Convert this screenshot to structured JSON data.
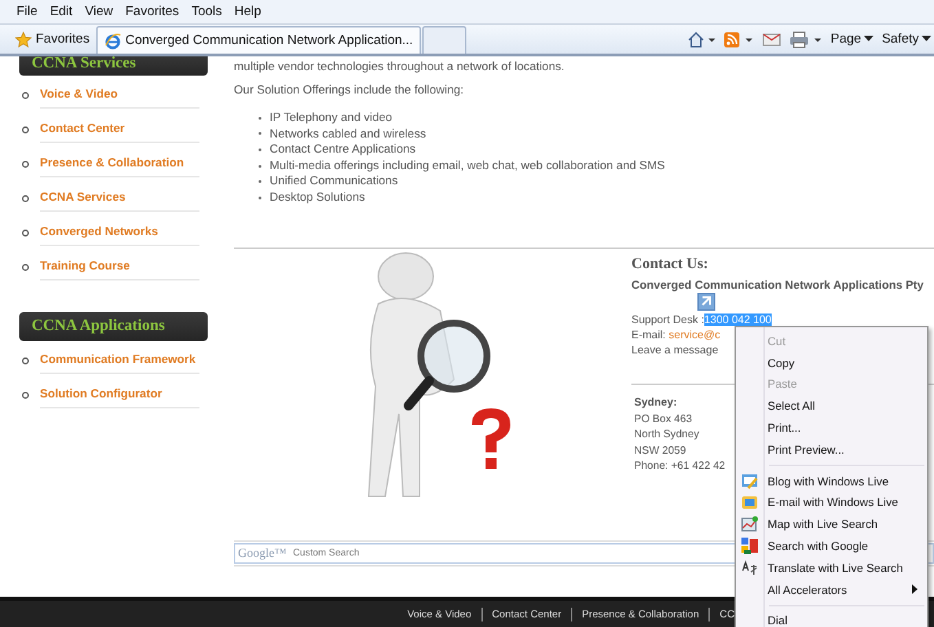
{
  "menu_bar": [
    "File",
    "Edit",
    "View",
    "Favorites",
    "Tools",
    "Help"
  ],
  "favorites_button": "Favorites",
  "tabs": [
    {
      "label": "Converged Communication Network Application...",
      "selected": true
    },
    {
      "selected": false
    }
  ],
  "command_bar": [
    {
      "kind": "home"
    },
    {
      "kind": "feeds"
    },
    {
      "kind": "mail"
    },
    {
      "kind": "print"
    },
    {
      "kind": "text",
      "label": "Page"
    },
    {
      "kind": "text",
      "label": "Safety"
    }
  ],
  "sidebar": [
    {
      "title": "CCNA Services",
      "items": [
        "Voice & Video",
        "Contact Center",
        "Presence & Collaboration",
        "CCNA Services",
        "Converged Networks",
        "Training Course"
      ]
    },
    {
      "title": "CCNA Applications",
      "items": [
        "Communication Framework",
        "Solution Configurator"
      ]
    }
  ],
  "intro": "multiple vendor technologies throughout a network of locations.",
  "offerings_heading": "Our Solution Offerings include the following:",
  "offerings": [
    "IP Telephony and video",
    "Networks cabled and wireless",
    "Contact Centre Applications",
    "Multi-media offerings including email, web chat, web collaboration and SMS",
    "Unified Communications",
    "Desktop Solutions"
  ],
  "contact": {
    "title": "Contact Us:",
    "company": "Converged Communication Network Applications Pty",
    "support_label": "Support Desk :",
    "support_number": "1300 042 100",
    "email_label": "E-mail:",
    "email": "service@c",
    "message": "Leave a message"
  },
  "office": {
    "city": "Sydney:",
    "lines": [
      "PO Box 463",
      "North Sydney",
      "NSW 2059",
      "Phone: +61 422 42"
    ]
  },
  "search": {
    "logo": "Google™",
    "placeholder": "Custom Search"
  },
  "footer_links": [
    "Voice & Video",
    "Contact Center",
    "Presence & Collaboration",
    "CC"
  ],
  "context_menu": [
    {
      "kind": "plain",
      "label": "Cut",
      "disabled": true
    },
    {
      "kind": "plain",
      "label": "Copy",
      "disabled": false
    },
    {
      "kind": "plain",
      "label": "Paste",
      "disabled": true
    },
    {
      "kind": "plain",
      "label": "Select All",
      "disabled": false
    },
    {
      "kind": "plain",
      "label": "Print...",
      "disabled": false
    },
    {
      "kind": "plain",
      "label": "Print Preview...",
      "disabled": false
    },
    {
      "kind": "separator"
    },
    {
      "kind": "blog",
      "label": "Blog with Windows Live",
      "disabled": false
    },
    {
      "kind": "email",
      "label": "E-mail with Windows Live",
      "disabled": false
    },
    {
      "kind": "map",
      "label": "Map with Live Search",
      "disabled": false
    },
    {
      "kind": "google",
      "label": "Search with Google",
      "disabled": false
    },
    {
      "kind": "translate",
      "label": "Translate with Live Search",
      "disabled": false
    },
    {
      "kind": "submenu",
      "label": "All Accelerators",
      "disabled": false
    },
    {
      "kind": "separator"
    },
    {
      "kind": "plain",
      "label": "Dial",
      "disabled": false
    }
  ]
}
